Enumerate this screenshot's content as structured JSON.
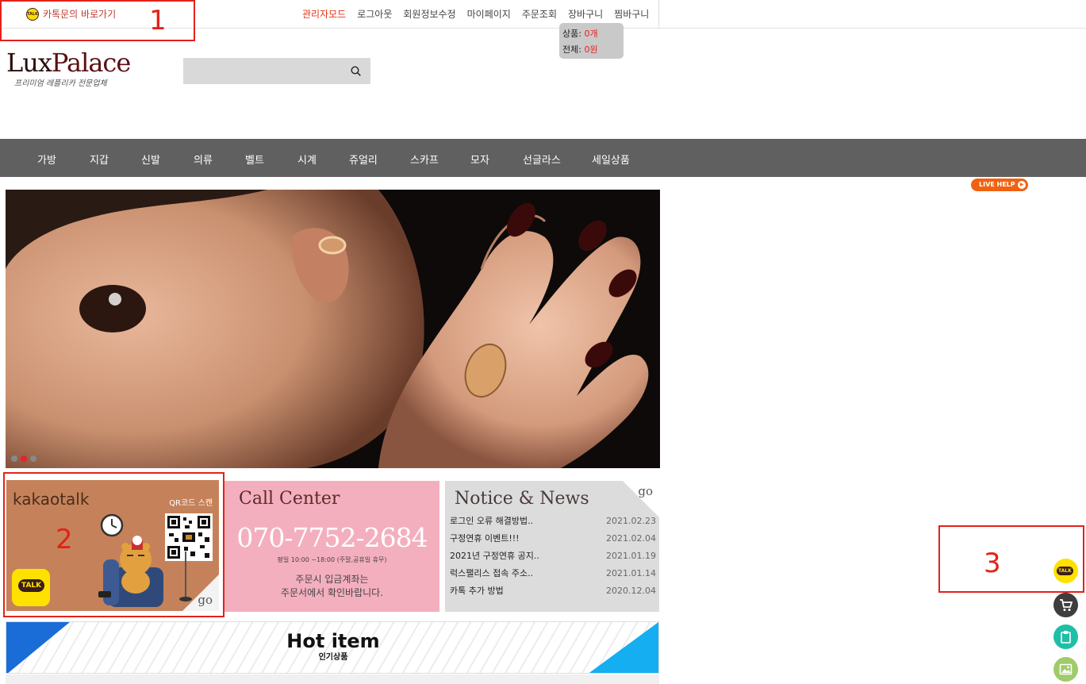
{
  "topbar": {
    "kakao_link": "카톡문의 바로가기",
    "nav": [
      "관리자모드",
      "로그아웃",
      "회원정보수정",
      "마이페이지",
      "주문조회",
      "장바구니",
      "찜바구니"
    ],
    "cart_popup": {
      "items_label": "상품:",
      "items_value": "0개",
      "total_label": "전체:",
      "total_value": "0원"
    }
  },
  "annotations": [
    "1",
    "2",
    "3"
  ],
  "logo": {
    "lux": "Lux",
    "palace": "Palace",
    "tagline": "프리미엄 레플리카 전문업체"
  },
  "search": {
    "placeholder": ""
  },
  "categories": [
    "가방",
    "지갑",
    "신발",
    "의류",
    "벨트",
    "시계",
    "쥬얼리",
    "스카프",
    "모자",
    "선글라스",
    "세일상품"
  ],
  "live_help": "LIVE HELP",
  "hero": {
    "slides": 3,
    "active_slide": 2
  },
  "kakao_banner": {
    "title": "kakaotalk",
    "qr_label": "QR코드 스캔",
    "talk": "TALK",
    "go": "go"
  },
  "call_banner": {
    "title": "Call Center",
    "number": "070-7752-2684",
    "hours": "평일 10:00 ~18:00 (주말,공휴일 휴무)",
    "msg_line1": "주문시 입금계좌는",
    "msg_line2": "주문서에서 확인바랍니다."
  },
  "notice_banner": {
    "title": "Notice & News",
    "go": "go",
    "items": [
      {
        "title": "로그인 오류 해결방법..",
        "date": "2021.02.23"
      },
      {
        "title": "구정연휴 이벤트!!!",
        "date": "2021.02.04"
      },
      {
        "title": "2021년 구정연휴 공지..",
        "date": "2021.01.19"
      },
      {
        "title": "럭스팰리스 접속 주소..",
        "date": "2021.01.14"
      },
      {
        "title": "카톡 추가 방법",
        "date": "2020.12.04"
      }
    ]
  },
  "hot_item": {
    "title": "Hot item",
    "subtitle": "인기상품"
  },
  "floating": {
    "talk": "TALK"
  }
}
